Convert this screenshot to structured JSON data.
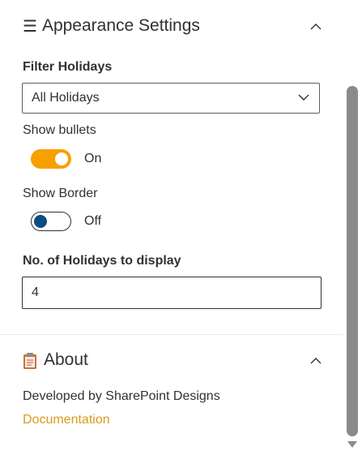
{
  "appearance": {
    "title": "Appearance Settings",
    "hamburger": "☰",
    "filter_label": "Filter Holidays",
    "filter_value": "All Holidays",
    "bullets_label": "Show bullets",
    "bullets_state": "On",
    "border_label": "Show Border",
    "border_state": "Off",
    "count_label": "No. of Holidays to display",
    "count_value": "4"
  },
  "about": {
    "title": "About",
    "developed_by": "Developed by SharePoint Designs",
    "doc_link": "Documentation"
  },
  "colors": {
    "toggle_on": "#f7a000",
    "toggle_off_knob": "#0f4b80",
    "link": "#d99a1c"
  },
  "icons": {
    "appearance": "hamburger-icon",
    "about": "clipboard-icon",
    "collapse": "chevron-up-icon",
    "dropdown": "chevron-down-icon"
  }
}
